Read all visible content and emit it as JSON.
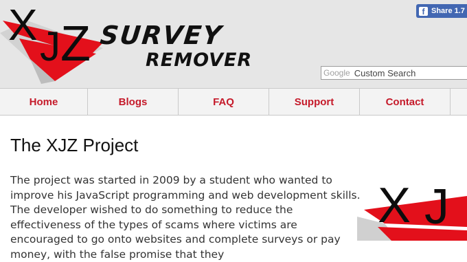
{
  "header": {
    "logo_letters": [
      "X",
      "J",
      "Z"
    ],
    "brand_line1": "SURVEY",
    "brand_line2": "REMOVER",
    "share": {
      "label": "Share 1.7",
      "icon": "facebook-icon"
    },
    "search": {
      "brand": "Google",
      "placeholder": "Custom Search"
    }
  },
  "nav": {
    "items": [
      {
        "label": "Home"
      },
      {
        "label": "Blogs"
      },
      {
        "label": "FAQ"
      },
      {
        "label": "Support"
      },
      {
        "label": "Contact"
      }
    ],
    "color": "#c51a2a"
  },
  "main": {
    "title": "The XJZ Project",
    "paragraph": "The project was started in 2009 by a student who wanted to improve his JavaScript programming and web development skills. The developer wished to do something to reduce the effectiveness of the types of scams where victims are encouraged to go onto websites and complete surveys or pay money, with the false promise that they",
    "side_logo_letters": [
      "X",
      "J"
    ]
  },
  "colors": {
    "brand_red": "#e3101b",
    "header_bg": "#e6e6e6",
    "facebook_blue": "#4267b2"
  }
}
